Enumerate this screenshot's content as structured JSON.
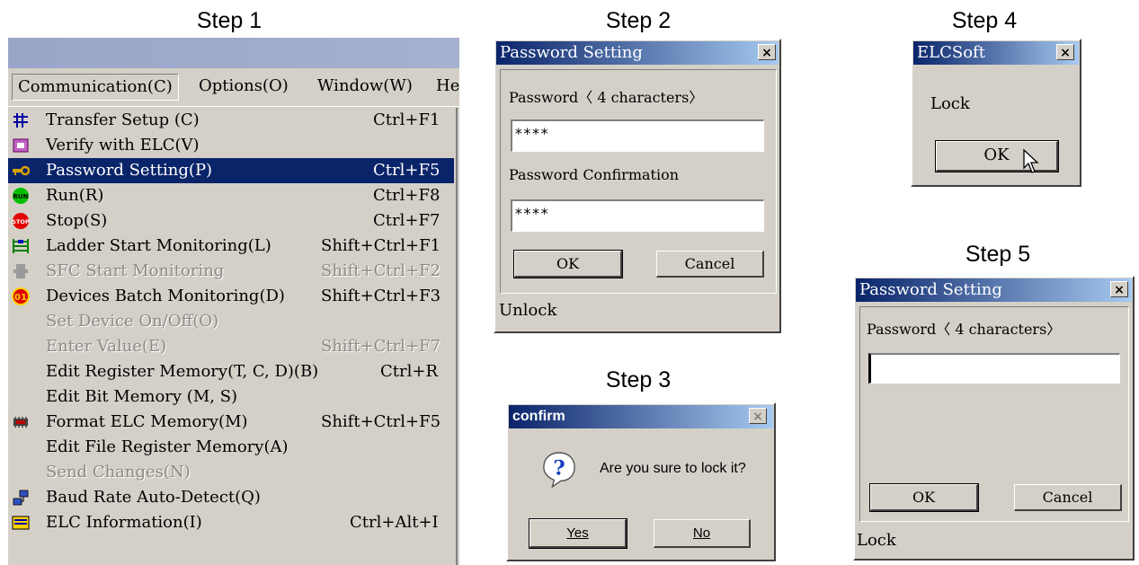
{
  "steps": {
    "s1": "Step 1",
    "s2": "Step 2",
    "s3": "Step 3",
    "s4": "Step 4",
    "s5": "Step 5"
  },
  "menubar": {
    "communication": "Communication(C)",
    "options": "Options(O)",
    "window": "Window(W)",
    "help": "He"
  },
  "menu_items": [
    {
      "label": "Transfer Setup (C)",
      "shortcut": "Ctrl+F1",
      "icon": "transfer-setup-icon"
    },
    {
      "label": "Verify with ELC(V)",
      "shortcut": "",
      "icon": "verify-icon"
    },
    {
      "label": "Password Setting(P)",
      "shortcut": "Ctrl+F5",
      "icon": "key-icon"
    },
    {
      "label": "Run(R)",
      "shortcut": "Ctrl+F8",
      "icon": "run-icon"
    },
    {
      "label": "Stop(S)",
      "shortcut": "Ctrl+F7",
      "icon": "stop-icon"
    },
    {
      "label": "Ladder Start Monitoring(L)",
      "shortcut": "Shift+Ctrl+F1",
      "icon": "ladder-monitor-icon"
    },
    {
      "label": "SFC Start Monitoring",
      "shortcut": "Shift+Ctrl+F2",
      "icon": "sfc-monitor-icon"
    },
    {
      "label": "Devices Batch Monitoring(D)",
      "shortcut": "Shift+Ctrl+F3",
      "icon": "devices-monitor-icon"
    },
    {
      "label": "Set Device On/Off(O)",
      "shortcut": "",
      "icon": ""
    },
    {
      "label": "Enter Value(E)",
      "shortcut": "Shift+Ctrl+F7",
      "icon": ""
    },
    {
      "label": "Edit Register Memory(T, C, D)(B)",
      "shortcut": "Ctrl+R",
      "icon": ""
    },
    {
      "label": "Edit Bit Memory (M, S)",
      "shortcut": "",
      "icon": ""
    },
    {
      "label": "Format ELC Memory(M)",
      "shortcut": "Shift+Ctrl+F5",
      "icon": "format-memory-icon"
    },
    {
      "label": "Edit File Register Memory(A)",
      "shortcut": "",
      "icon": ""
    },
    {
      "label": "Send Changes(N)",
      "shortcut": "",
      "icon": ""
    },
    {
      "label": "Baud Rate Auto-Detect(Q)",
      "shortcut": "",
      "icon": "baud-rate-icon"
    },
    {
      "label": "ELC Information(I)",
      "shortcut": "Ctrl+Alt+I",
      "icon": "elc-info-icon"
    }
  ],
  "dlg2": {
    "title": "Password Setting",
    "close": "×",
    "password_label": "Password〈 4 characters〉",
    "password_value": "****",
    "confirm_label": "Password Confirmation",
    "confirm_value": "****",
    "ok": "OK",
    "cancel": "Cancel",
    "status": "Unlock"
  },
  "dlg3": {
    "title": "confirm",
    "close": "×",
    "icon": "?",
    "message": "Are you sure to lock it?",
    "yes": "Yes",
    "no": "No"
  },
  "dlg4": {
    "title": "ELCSoft",
    "close": "×",
    "message": "Lock",
    "ok": "OK"
  },
  "dlg5": {
    "title": "Password Setting",
    "close": "×",
    "password_label": "Password〈 4 characters〉",
    "password_value": "",
    "ok": "OK",
    "cancel": "Cancel",
    "status": "Lock"
  }
}
